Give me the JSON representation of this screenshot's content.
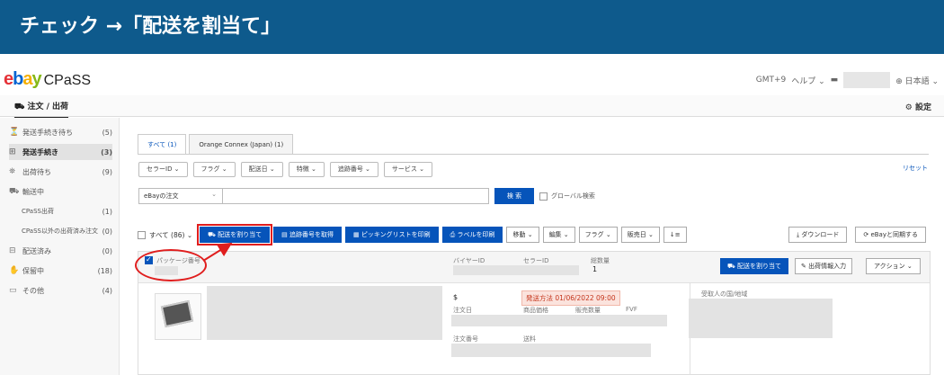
{
  "banner": {
    "title": "チェック →「配送を割当て」"
  },
  "header": {
    "logo_parts": [
      "e",
      "b",
      "a",
      "y"
    ],
    "app_name": "CPaSS",
    "timezone": "GMT+9",
    "help": "ヘルプ ⌄",
    "language": "⊕ 日本語 ⌄"
  },
  "subnav": {
    "tab": "注文 / 出荷",
    "settings": "設定"
  },
  "sidebar": {
    "items": [
      {
        "icon": "⏳",
        "label": "発送手続き待ち",
        "count": "(5)"
      },
      {
        "icon": "⊞",
        "label": "発送手続き",
        "count": "(3)",
        "active": true
      },
      {
        "icon": "⛯",
        "label": "出荷待ち",
        "count": "(9)"
      },
      {
        "icon": "⛟",
        "label": "輸送中",
        "count": ""
      },
      {
        "icon": "",
        "label": "CPaSS出荷",
        "count": "(1)",
        "sub": true
      },
      {
        "icon": "",
        "label": "CPaSS以外の出荷済み注文",
        "count": "(0)",
        "sub": true
      },
      {
        "icon": "⊟",
        "label": "配送済み",
        "count": "(0)"
      },
      {
        "icon": "✋",
        "label": "保留中",
        "count": "(18)"
      },
      {
        "icon": "▭",
        "label": "その他",
        "count": "(4)"
      }
    ]
  },
  "tabs": [
    {
      "label": "すべて (1)",
      "active": true
    },
    {
      "label": "Orange Connex (Japan) (1)",
      "active": false
    }
  ],
  "filters": [
    "セラーID ⌄",
    "フラグ ⌄",
    "配送日 ⌄",
    "特徴 ⌄",
    "追跡番号 ⌄",
    "サービス ⌄"
  ],
  "reset": "リセット",
  "search": {
    "select": "eBayの注文",
    "button": "検 索",
    "global": "グローバル検索"
  },
  "actions": {
    "select_all": "すべて (86) ⌄",
    "assign": "⛟ 配送を割り当て",
    "tracking": "▤ 追跡番号を取得",
    "picking": "▦ ピッキングリストを印刷",
    "label": "⎙ ラベルを印刷",
    "move": "移動 ⌄",
    "edit": "編集 ⌄",
    "flag": "フラグ ⌄",
    "sales_date": "販売日 ⌄",
    "sort": "↓≡",
    "download": "⤓ ダウンロード",
    "ebay_sync": "⟳ eBayと同期する"
  },
  "order": {
    "package_label": "パッケージ番号",
    "buyer_label": "バイヤーID",
    "seller_label": "セラーID",
    "total_label": "総数量",
    "total_value": "1",
    "assign_btn": "⛟ 配送を割り当て",
    "invoice_btn": "✎ 出荷情報入力",
    "action_btn": "アクション ⌄",
    "price": "$",
    "ship_deadline": "発送方法 01/06/2022 09:00",
    "order_date_label": "注文日",
    "item_price_label": "商品価格",
    "qty_label": "販売数量",
    "fvf_label": "FVF",
    "order_no_label": "注文番号",
    "shipping_label": "送料",
    "recipient_label": "受取人の国/地域"
  },
  "colors": {
    "banner": "#0e5a8c",
    "primary": "#0654ba",
    "annotation": "#e01e1e"
  }
}
